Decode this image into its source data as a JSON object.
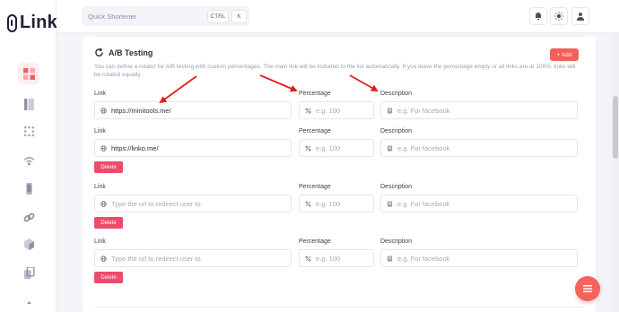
{
  "app": {
    "name": "Linko"
  },
  "topbar": {
    "search_placeholder": "Quick Shortener",
    "shortcut_keys": [
      "CTRL",
      "K"
    ]
  },
  "section": {
    "title": "A/B Testing",
    "add_label": "+ Add",
    "description": "You can define a rotator for A/B testing with custom percentages. The main link will be included to the list automatically. If you leave the percentage empty or all links are at 100%, links will be rotated equally."
  },
  "labels": {
    "link": "Link",
    "percentage": "Percentage",
    "description": "Description"
  },
  "placeholders": {
    "link": "Type the url to redirect user to.",
    "percentage": "e.g. 100",
    "description": "e.g. For facebook"
  },
  "delete_label": "Delete",
  "rows": [
    {
      "link_value": "https://minitools.me/",
      "has_delete": false
    },
    {
      "link_value": "https://linko.me/",
      "has_delete": true
    },
    {
      "link_value": "",
      "has_delete": true
    },
    {
      "link_value": "",
      "has_delete": true
    }
  ],
  "colors": {
    "accent": "#f25f5c",
    "delete": "#ee4b6a",
    "arrow": "#e01e1e"
  }
}
